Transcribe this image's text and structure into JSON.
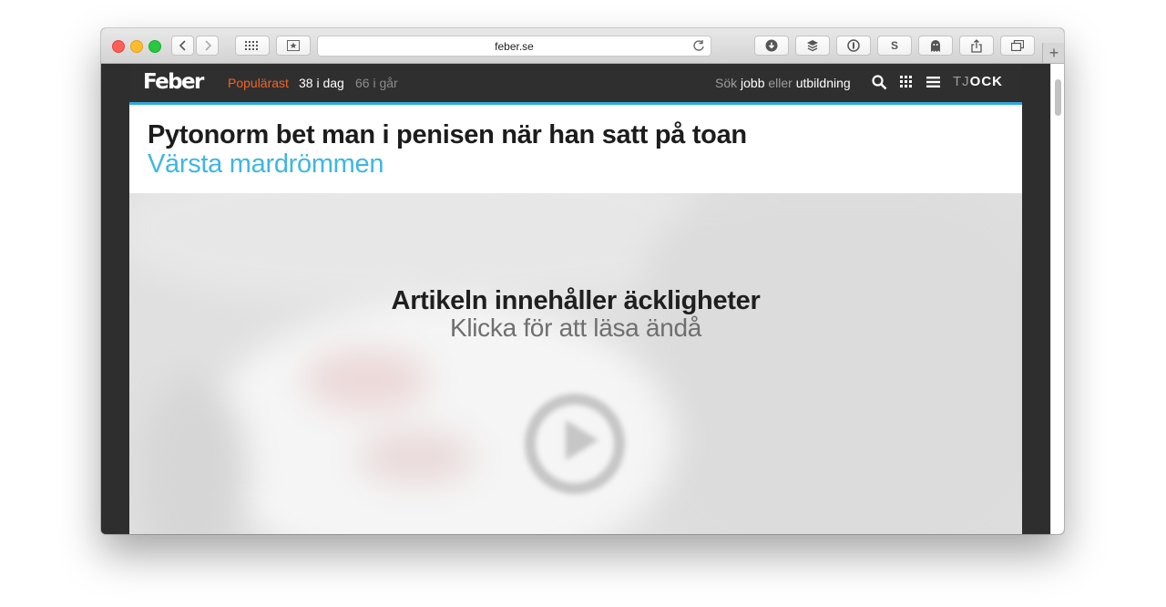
{
  "browser": {
    "url": "feber.se"
  },
  "site": {
    "logo": "Feber",
    "nav": {
      "popular": "Populärast",
      "today": "38 i dag",
      "yesterday": "66 i går"
    },
    "search_prompt": {
      "part1": "Sök ",
      "part2": "jobb",
      "part3": " eller ",
      "part4": "utbildning"
    },
    "tjock_light": "TJ",
    "tjock_bold": "OCK"
  },
  "article": {
    "headline": "Pytonorm bet man i penisen när han satt på toan",
    "subheadline": "Värsta mardrömmen",
    "warning": {
      "title": "Artikeln innehåller äckligheter",
      "cta": "Klicka för att läsa ändå"
    }
  },
  "colors": {
    "accent_blue": "#2ea9df",
    "popular_orange": "#f06428",
    "nav_bg": "#2f2f2f"
  }
}
